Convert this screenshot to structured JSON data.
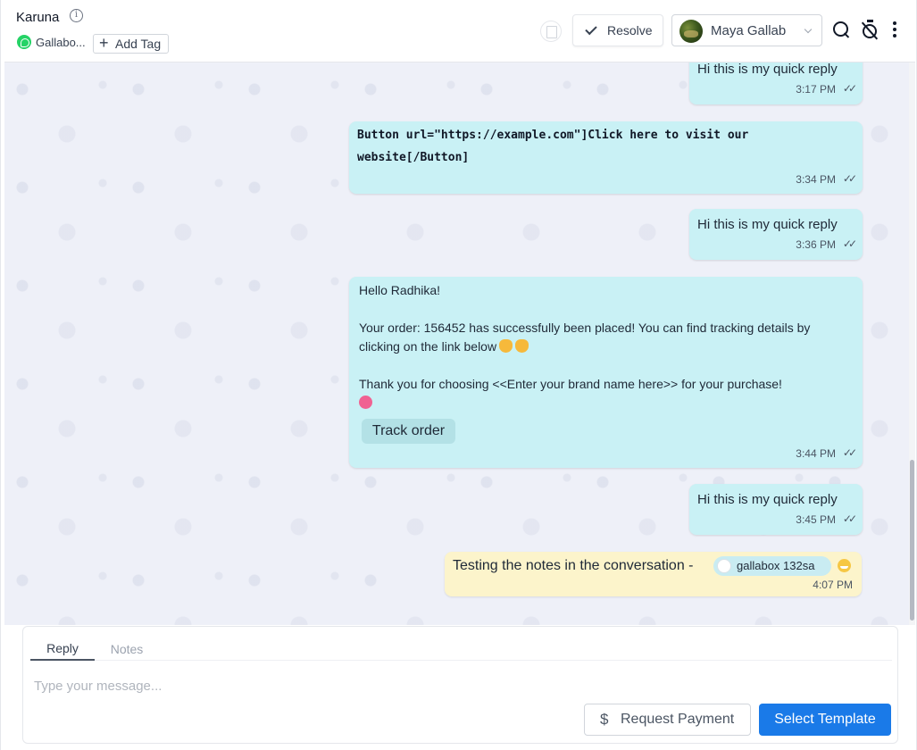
{
  "header": {
    "contact_name": "Karuna",
    "info_glyph": "i",
    "channel_name": "Gallabo...",
    "add_tag_label": "Add Tag",
    "add_tag_glyph": "+",
    "resolve_label": "Resolve",
    "agent_name": "Maya Gallab",
    "icons": [
      "info-icon",
      "whatsapp-icon",
      "document-icon",
      "check-icon",
      "chevron-down-icon",
      "search-icon",
      "snooze-off-icon",
      "more-vertical-icon"
    ]
  },
  "messages": [
    {
      "text": "Hi this is my quick reply",
      "time": "3:17 PM",
      "ticks": "✓✓"
    },
    {
      "line1": "Button url=\"https://example.com\"]Click here to visit our",
      "line2": "website[/Button]",
      "time": "3:34 PM",
      "ticks": "✓✓"
    },
    {
      "text": "Hi this is my quick reply",
      "time": "3:36 PM",
      "ticks": "✓✓"
    },
    {
      "greeting": "Hello Radhika!",
      "body1": " Your order: 156452 has successfully been placed! You can find tracking details by clicking on the link below",
      "body2": " Thank you for choosing <<Enter your brand name here>> for your purchase!",
      "button_label": "Track order",
      "time": "3:44 PM",
      "ticks": "✓✓"
    },
    {
      "text": "Hi this is my quick reply",
      "time": "3:45 PM",
      "ticks": "✓✓"
    }
  ],
  "note": {
    "text": "Testing the notes in the conversation -",
    "mention": "gallabox 132sa",
    "time": "4:07 PM"
  },
  "composer": {
    "tab_reply": "Reply",
    "tab_notes": "Notes",
    "placeholder": "Type your message...",
    "request_payment_label": "Request Payment",
    "dollar_glyph": "$",
    "select_template_label": "Select Template"
  },
  "colors": {
    "accent": "#1a7ae8",
    "outgoing_bubble": "#c9f1f5",
    "note_bubble": "#fcf4cb",
    "chat_background": "#eef0f8",
    "whatsapp": "#25d366"
  }
}
